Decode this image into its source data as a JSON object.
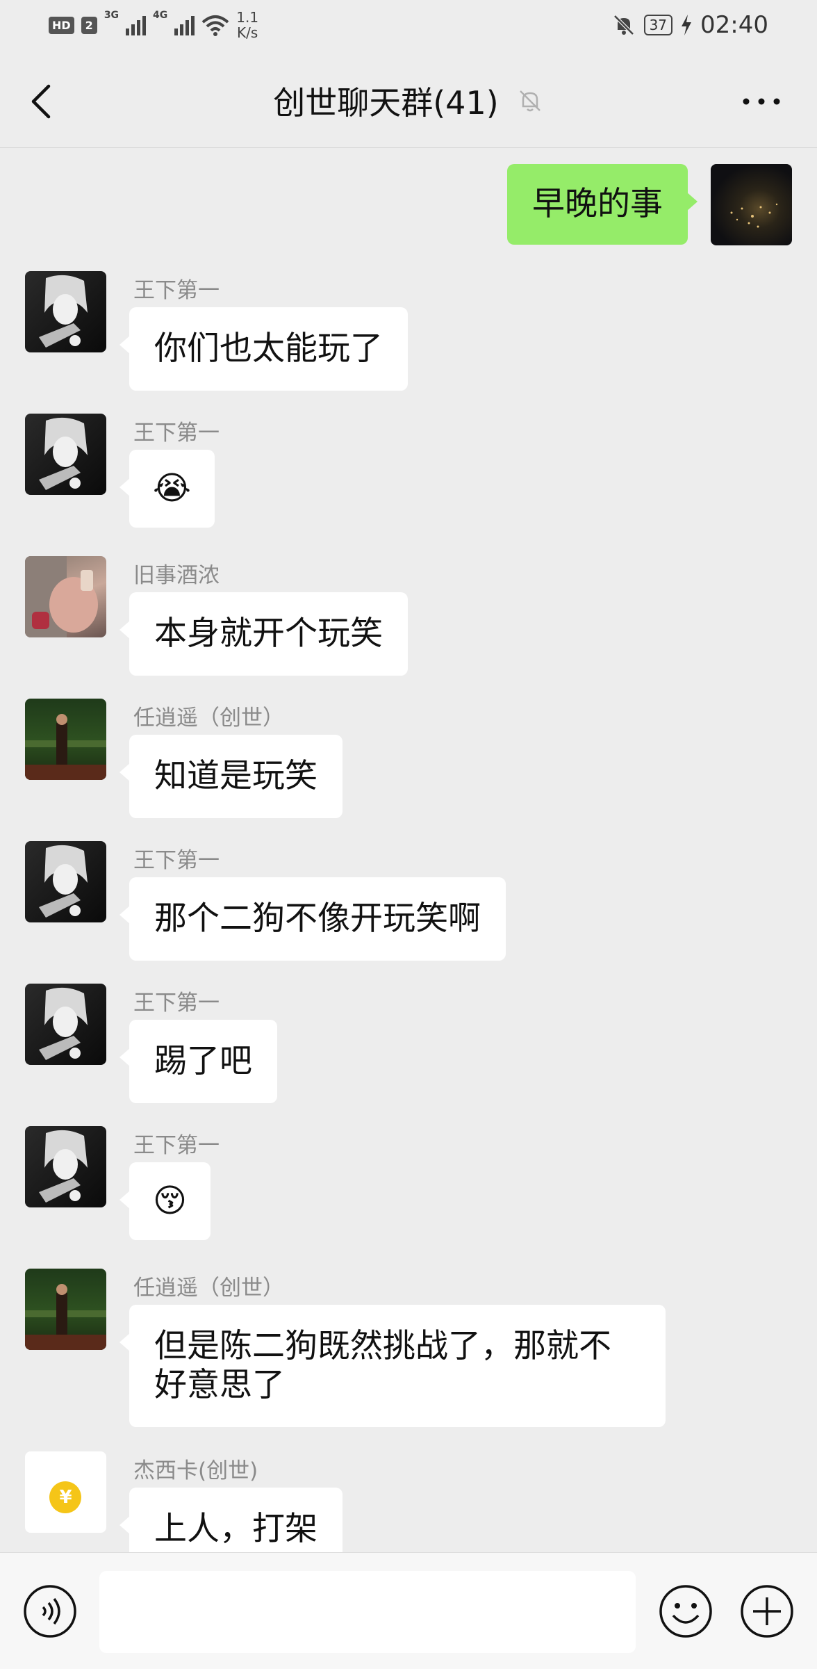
{
  "status_bar": {
    "hd_label": "HD",
    "sim_label": "2",
    "net1_label": "3G",
    "net2_label": "4G",
    "speed_value": "1.1",
    "speed_unit": "K/s",
    "battery": "37",
    "time": "02:40"
  },
  "header": {
    "title": "创世聊天群(41)"
  },
  "own_message": {
    "text": "早晚的事"
  },
  "messages": [
    {
      "sender": "王下第一",
      "text": "你们也太能玩了"
    },
    {
      "sender": "王下第一",
      "text": "😭"
    },
    {
      "sender": "旧事酒浓",
      "text": "本身就开个玩笑"
    },
    {
      "sender": "任逍遥（创世）",
      "text": "知道是玩笑"
    },
    {
      "sender": "王下第一",
      "text": "那个二狗不像开玩笑啊"
    },
    {
      "sender": "王下第一",
      "text": "踢了吧"
    },
    {
      "sender": "王下第一",
      "text": "😚"
    },
    {
      "sender": "任逍遥（创世）",
      "text": "但是陈二狗既然挑战了，那就不好意思了"
    },
    {
      "sender": "杰西卡(创世)",
      "text": "上人，打架"
    }
  ],
  "avatar_badges": {
    "coin_symbol": "¥"
  },
  "input_bar": {
    "value": ""
  },
  "colors": {
    "background": "#ededed",
    "own_bubble": "#95ec69",
    "other_bubble": "#ffffff",
    "sender_name": "#8a8a8a"
  },
  "icons": {
    "back": "chevron-left-icon",
    "mute": "bell-off-icon",
    "more": "more-dots-icon",
    "voice": "voice-icon",
    "emoji": "smiley-icon",
    "plus": "plus-circle-icon"
  }
}
